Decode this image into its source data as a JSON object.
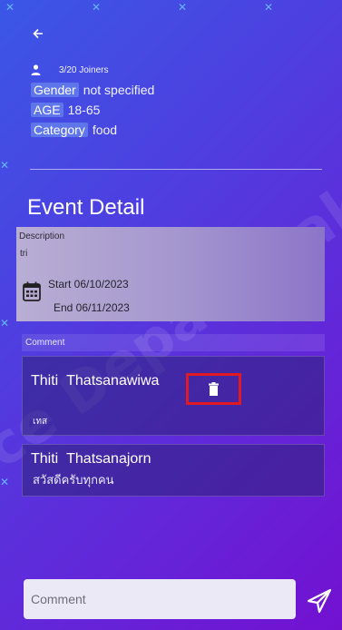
{
  "header": {
    "back_icon": "arrow-left-icon"
  },
  "event": {
    "person_icon": "person-icon",
    "joiners": "3/20 Joiners",
    "gender_tag": "Gender",
    "gender_value": "not specified",
    "age_tag": "AGE",
    "age_value": "18-65",
    "category_tag": "Category",
    "category_value": "food"
  },
  "detail": {
    "title": "Event Detail",
    "description_label": "Description",
    "description_value": "tri",
    "calendar_icon": "calendar-icon",
    "start": "Start 06/10/2023",
    "end": "End 06/11/2023"
  },
  "comments": {
    "header": "Comment",
    "items": [
      {
        "first_name": "Thiti",
        "last_name": "Thatsanawiwa",
        "text": "เทส",
        "delete_icon": "trash-icon"
      },
      {
        "first_name": "Thiti",
        "last_name": "Thatsanajorn",
        "text": "สวัสดีครับทุกคน"
      }
    ]
  },
  "composer": {
    "placeholder": "Comment",
    "send_icon": "send-icon"
  },
  "colors": {
    "gradient_start": "#3a57e6",
    "gradient_end": "#7311d1",
    "highlight": "#e01a22"
  }
}
